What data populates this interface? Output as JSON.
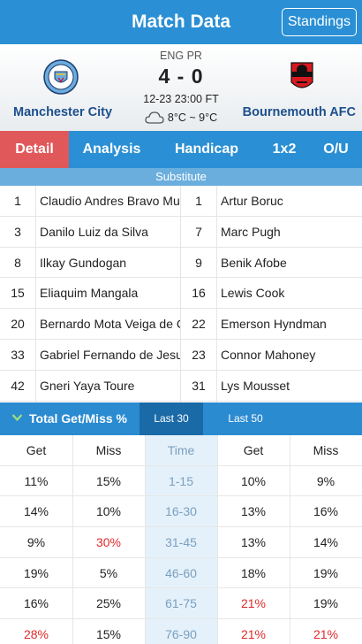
{
  "header": {
    "title": "Match Data",
    "standings_label": "Standings"
  },
  "match": {
    "league": "ENG PR",
    "score": "4 - 0",
    "datetime": "12-23 23:00 FT",
    "weather": "8°C ~ 9°C",
    "home_team": "Manchester City",
    "away_team": "Bournemouth AFC"
  },
  "tabs": [
    {
      "label": "Detail",
      "active": true
    },
    {
      "label": "Analysis",
      "active": false
    },
    {
      "label": "Handicap",
      "active": false
    },
    {
      "label": "1x2",
      "active": false
    },
    {
      "label": "O/U",
      "active": false
    }
  ],
  "substitute": {
    "title": "Substitute",
    "rows": [
      {
        "home_num": "1",
        "home_name": "Claudio Andres Bravo Munoz",
        "away_num": "1",
        "away_name": "Artur Boruc"
      },
      {
        "home_num": "3",
        "home_name": "Danilo Luiz da Silva",
        "away_num": "7",
        "away_name": "Marc Pugh"
      },
      {
        "home_num": "8",
        "home_name": "Ilkay Gundogan",
        "away_num": "9",
        "away_name": "Benik Afobe"
      },
      {
        "home_num": "15",
        "home_name": "Eliaquim Mangala",
        "away_num": "16",
        "away_name": "Lewis Cook"
      },
      {
        "home_num": "20",
        "home_name": "Bernardo Mota Veiga de Carvalho",
        "away_num": "22",
        "away_name": "Emerson Hyndman"
      },
      {
        "home_num": "33",
        "home_name": "Gabriel Fernando de Jesus",
        "away_num": "23",
        "away_name": "Connor Mahoney"
      },
      {
        "home_num": "42",
        "home_name": "Gneri Yaya Toure",
        "away_num": "31",
        "away_name": "Lys Mousset"
      }
    ]
  },
  "getmiss": {
    "title": "Total Get/Miss %",
    "tab_last30": "Last 30",
    "tab_last50": "Last 50",
    "columns": [
      "Get",
      "Miss",
      "Time",
      "Get",
      "Miss"
    ],
    "rows": [
      {
        "cells": [
          "11%",
          "15%",
          "1-15",
          "10%",
          "9%"
        ],
        "red": [
          false,
          false,
          false,
          false,
          false
        ]
      },
      {
        "cells": [
          "14%",
          "10%",
          "16-30",
          "13%",
          "16%"
        ],
        "red": [
          false,
          false,
          false,
          false,
          false
        ]
      },
      {
        "cells": [
          "9%",
          "30%",
          "31-45",
          "13%",
          "14%"
        ],
        "red": [
          false,
          true,
          false,
          false,
          false
        ]
      },
      {
        "cells": [
          "19%",
          "5%",
          "46-60",
          "18%",
          "19%"
        ],
        "red": [
          false,
          false,
          false,
          false,
          false
        ]
      },
      {
        "cells": [
          "16%",
          "25%",
          "61-75",
          "21%",
          "19%"
        ],
        "red": [
          false,
          false,
          false,
          true,
          false
        ]
      },
      {
        "cells": [
          "28%",
          "15%",
          "76-90",
          "21%",
          "21%"
        ],
        "red": [
          true,
          false,
          false,
          true,
          true
        ]
      }
    ]
  },
  "colors": {
    "primary": "#2a8fd4",
    "active_tab": "#e0585a",
    "highlight_red": "#e02a2a"
  }
}
